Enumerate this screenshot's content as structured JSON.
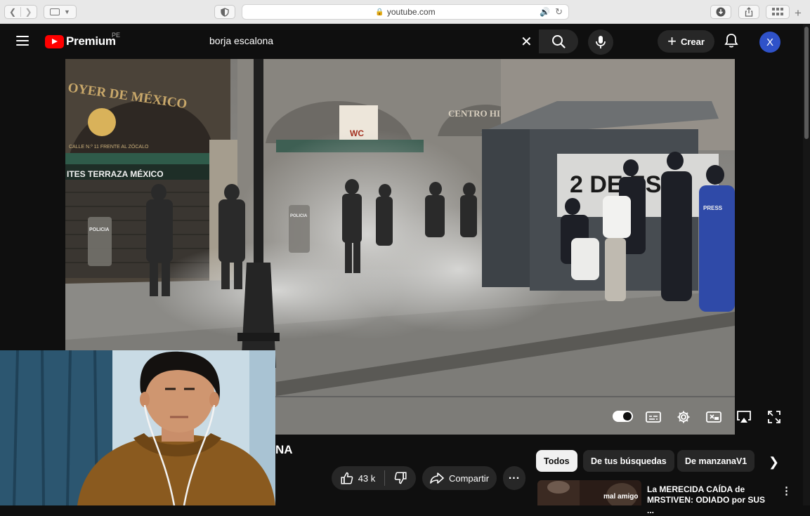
{
  "browser": {
    "url": "youtube.com"
  },
  "header": {
    "logo_text": "Premium",
    "country_code": "PE",
    "search_query": "borja escalona",
    "create_label": "Crear",
    "avatar_letter": "X"
  },
  "video": {
    "scene_text": {
      "restaurant_sign": "OYER DE MÉXICO",
      "restaurant_address": "CALLE N.º 11 FRENTE AL ZÓCALO",
      "awning": "ITES  TERRAZA  MÉXICO",
      "wc_sign": "WC",
      "centro_sign": "CENTRO HI",
      "police_shield_1": "POLICIA",
      "police_shield_2": "POLICIA",
      "kiosk_graffiti": "2 DE ESTU",
      "press_vest": "PRESS"
    }
  },
  "below": {
    "title_fragment": "NA",
    "like_count": "43 k",
    "share_label": "Compartir"
  },
  "chips": [
    {
      "label": "Todos"
    },
    {
      "label": "De tus búsquedas"
    },
    {
      "label": "De manzanaV1"
    }
  ],
  "recommendation": {
    "thumb_text": "mal amigo",
    "title": "La MERECIDA CAÍDA de MRSTIVEN: ODIADO por SUS ..."
  },
  "colors": {
    "brand_red": "#ff0000",
    "avatar_blue": "#2f52c9",
    "background": "#0f0f0f"
  }
}
